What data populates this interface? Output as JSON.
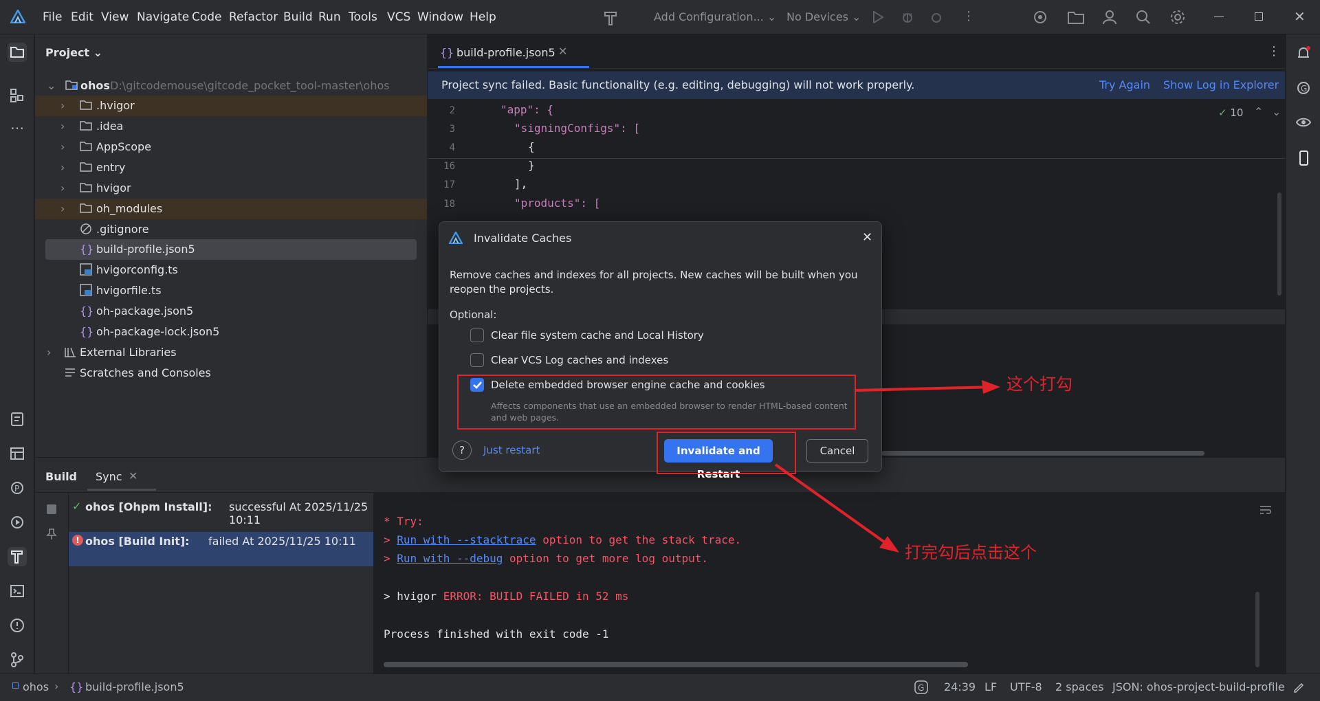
{
  "titlebar": {
    "menus": [
      "File",
      "Edit",
      "View",
      "Navigate",
      "Code",
      "Refactor",
      "Build",
      "Run",
      "Tools",
      "VCS",
      "Window",
      "Help"
    ],
    "add_configuration": "Add Configuration...",
    "no_devices": "No Devices"
  },
  "project": {
    "title": "Project",
    "root_name": "ohos",
    "root_path": "D:\\gitcodemouse\\gitcode_pocket_tool-master\\ohos",
    "items": [
      ".hvigor",
      ".idea",
      "AppScope",
      "entry",
      "hvigor",
      "oh_modules",
      ".gitignore",
      "build-profile.json5",
      "hvigorconfig.ts",
      "hvigorfile.ts",
      "oh-package.json5",
      "oh-package-lock.json5",
      "External Libraries",
      "Scratches and Consoles"
    ]
  },
  "editor": {
    "tab_label": "build-profile.json5",
    "banner_text": "Project sync failed. Basic functionality (e.g. editing, debugging) will not work properly.",
    "banner_try_again": "Try Again",
    "banner_show_log": "Show Log in Explorer",
    "problems_count": "10",
    "line_numbers": [
      "2",
      "3",
      "4",
      "16",
      "17",
      "18"
    ],
    "lines": [
      "\"app\": {",
      "\"signingConfigs\": [",
      "{",
      "}",
      "],",
      "\"products\": ["
    ]
  },
  "dialog": {
    "title": "Invalidate Caches",
    "description": "Remove caches and indexes for all projects. New caches will be built when you reopen the projects.",
    "optional_label": "Optional:",
    "option1": "Clear file system cache and Local History",
    "option2": "Clear VCS Log caches and indexes",
    "option3": "Delete embedded browser engine cache and cookies",
    "option3_note": "Affects components that use an embedded browser to render HTML-based content and web pages.",
    "option1_checked": false,
    "option2_checked": false,
    "option3_checked": true,
    "help_label": "?",
    "just_restart": "Just restart",
    "invalidate_button": "Invalidate and Restart",
    "cancel_button": "Cancel"
  },
  "annotations": {
    "check_note": "这个打勾",
    "click_note": "打完勾后点击这个"
  },
  "build": {
    "tab_build": "Build",
    "tab_sync": "Sync",
    "entry1_bold": "ohos [Ohpm Install]:",
    "entry1_rest": "successful At 2025/11/25 10:11",
    "entry2_bold": "ohos [Build Init]:",
    "entry2_rest": "failed At 2025/11/25 10:11",
    "console": {
      "try": "* Try:",
      "line1_prefix": "> ",
      "line1_link": "Run with --stacktrace",
      "line1_rest": " option to get the stack trace.",
      "line2_prefix": "> ",
      "line2_link": "Run with --debug",
      "line2_rest": " option to get more log output.",
      "hvigor_prefix": "> hvigor ",
      "hvigor_error": "ERROR: BUILD FAILED in 52 ms",
      "process": "Process finished with exit code -1"
    }
  },
  "statusbar": {
    "breadcrumb_root": "ohos",
    "breadcrumb_file": "build-profile.json5",
    "position": "24:39",
    "line_sep": "LF",
    "encoding": "UTF-8",
    "indent": "2 spaces",
    "schema": "JSON: ohos-project-build-profile"
  },
  "colors": {
    "accent": "#3574f0",
    "annotation": "#e0232b",
    "banner": "#25324d"
  }
}
